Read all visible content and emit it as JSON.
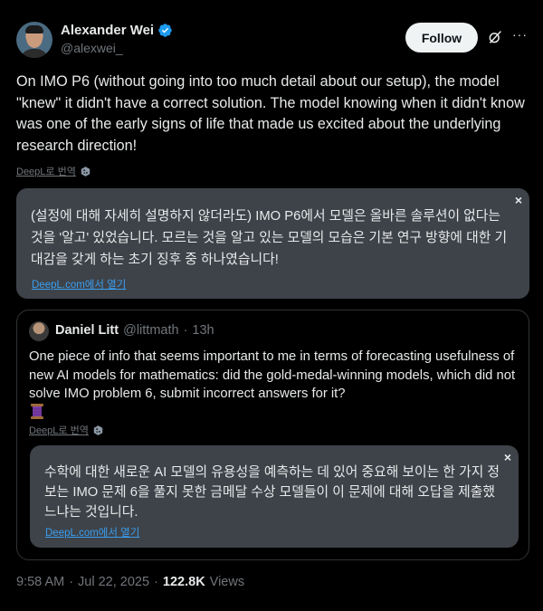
{
  "author": {
    "display_name": "Alexander Wei",
    "handle": "@alexwei_"
  },
  "actions": {
    "follow_label": "Follow",
    "grok_icon": "grok-icon",
    "more_icon": "more-icon",
    "more_label": "···"
  },
  "tweet": {
    "text": "On IMO P6 (without going into too much detail about our setup), the model \"knew\" it didn't have a correct solution. The model knowing when it didn't know was one of the early signs of life that made us excited about the underlying research direction!",
    "translate_label": "DeepL로 번역",
    "translation": {
      "text": "(설정에 대해 자세히 설명하지 않더라도) IMO P6에서 모델은 올바른 솔루션이 없다는 것을 '알고' 있었습니다. 모르는 것을 알고 있는 모델의 모습은 기본 연구 방향에 대한 기대감을 갖게 하는 초기 징후 중 하나였습니다!",
      "open_link": "DeepL.com에서 열기",
      "close_label": "×"
    }
  },
  "quote": {
    "display_name": "Daniel Litt",
    "handle": "@littmath",
    "separator": "·",
    "time": "13h",
    "text": "One piece of info that seems important to me in terms of forecasting usefulness of new AI models for mathematics: did the gold-medal-winning models, which did not solve IMO problem 6, submit incorrect answers for it?",
    "emoji": "thread-spool-emoji",
    "translate_label": "DeepL로 번역",
    "translation": {
      "text": "수학에 대한 새로운 AI 모델의 유용성을 예측하는 데 있어 중요해 보이는 한 가지 정보는 IMO 문제 6을 풀지 못한 금메달 수상 모델들이 이 문제에 대해 오답을 제출했느냐는 것입니다.",
      "open_link": "DeepL.com에서 열기",
      "close_label": "×"
    }
  },
  "meta": {
    "time": "9:58 AM",
    "separator1": "·",
    "date": "Jul 22, 2025",
    "separator2": "·",
    "views_count": "122.8K",
    "views_label": "Views"
  },
  "colors": {
    "background": "#000000",
    "text": "#e7e9ea",
    "muted": "#71767b",
    "verified": "#1d9bf0",
    "link": "#3b9eef",
    "translation_box": "#3e4349"
  }
}
